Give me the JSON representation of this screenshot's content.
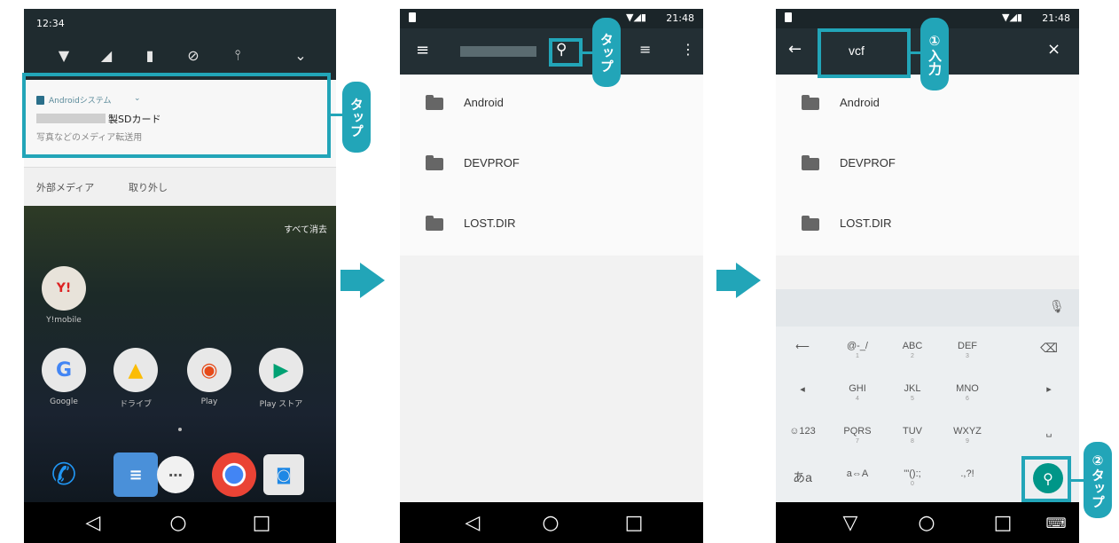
{
  "phone1": {
    "time": "12:34",
    "notification": {
      "app": "Androidシステム",
      "chevron": "⌄",
      "title": "製SDカード",
      "subtitle": "写真などのメディア転送用",
      "actions": [
        "外部メディア",
        "取り外し"
      ]
    },
    "clear_all": "すべて消去",
    "apps": {
      "row1": [
        {
          "label": "Y!mobile"
        }
      ],
      "row2": [
        {
          "label": "Google"
        },
        {
          "label": "ドライブ"
        },
        {
          "label": "Play"
        },
        {
          "label": "Play ストア"
        }
      ]
    },
    "callout": "タップ"
  },
  "phone2": {
    "time": "21:48",
    "files": [
      "Android",
      "DEVPROF",
      "LOST.DIR"
    ],
    "callout": "タップ"
  },
  "phone3": {
    "time": "21:48",
    "search_value": "vcf",
    "files": [
      "Android",
      "DEVPROF",
      "LOST.DIR"
    ],
    "callout1": "①入力",
    "callout2": "②タップ",
    "keyboard": {
      "row1": [
        {
          "m": "@-_/",
          "s": "1"
        },
        {
          "m": "ABC",
          "s": "2"
        },
        {
          "m": "DEF",
          "s": "3"
        }
      ],
      "row2": [
        {
          "m": "GHI",
          "s": "4"
        },
        {
          "m": "JKL",
          "s": "5"
        },
        {
          "m": "MNO",
          "s": "6"
        }
      ],
      "row3": [
        {
          "m": "PQRS",
          "s": "7"
        },
        {
          "m": "TUV",
          "s": "8"
        },
        {
          "m": "WXYZ",
          "s": "9"
        }
      ],
      "row4": [
        {
          "m": "a⇔A",
          "s": ""
        },
        {
          "m": "'\"():;",
          "s": "0"
        },
        {
          "m": ".,?!",
          "s": ""
        }
      ],
      "left": [
        "⟵",
        "◂",
        "☺123",
        "あa"
      ],
      "right": [
        "⌫",
        "▸",
        "␣",
        ""
      ]
    }
  },
  "colors": {
    "accent": "#22a5b8",
    "appbar": "#232f34",
    "search_button": "#009688"
  }
}
